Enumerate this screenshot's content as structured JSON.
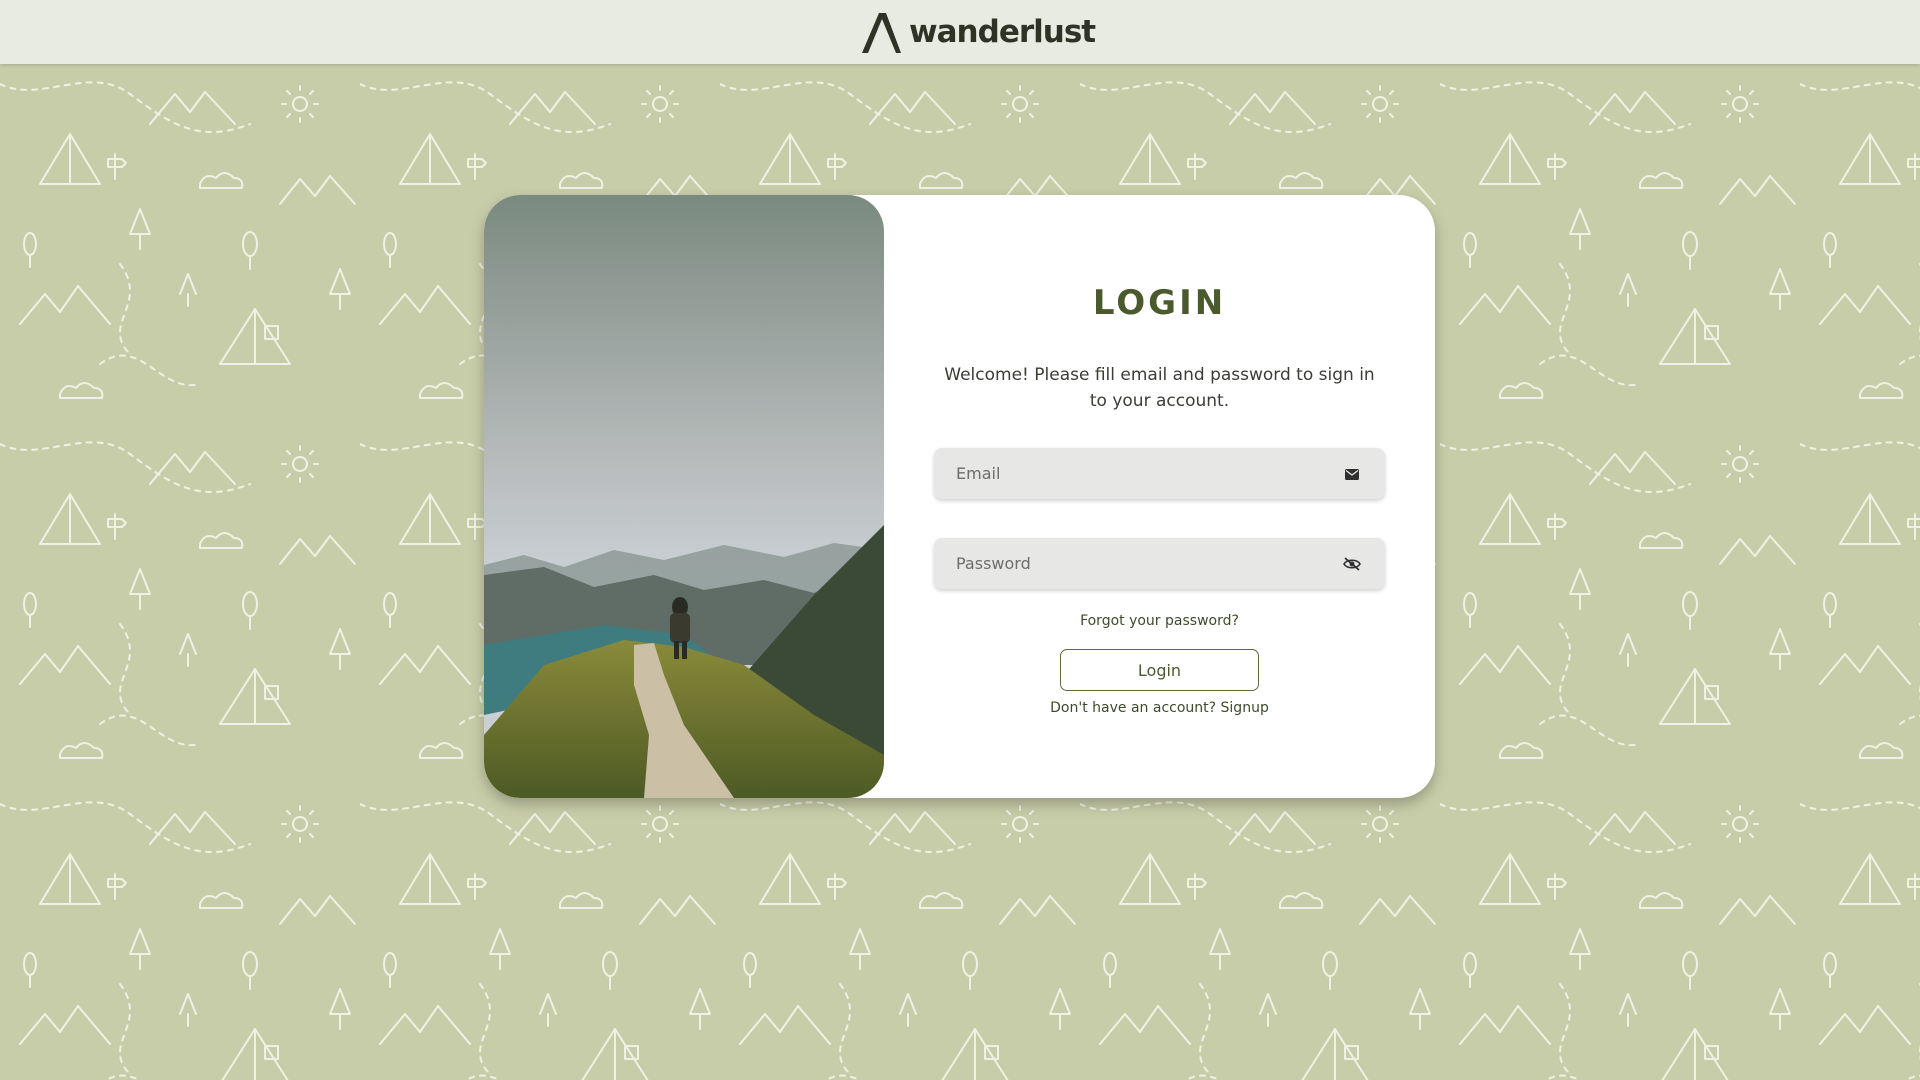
{
  "header": {
    "brand": "wanderlust"
  },
  "login": {
    "title": "LOGIN",
    "welcome": "Welcome! Please fill email and password to sign in to your account.",
    "email_placeholder": "Email",
    "password_placeholder": "Password",
    "forgot_label": "Forgot your password?",
    "button_label": "Login",
    "signup_prompt": "Don't have an account? ",
    "signup_link": "Signup"
  },
  "icons": {
    "email_field": "envelope-icon",
    "password_field": "eye-slash-icon"
  },
  "colors": {
    "background": "#c8cda9",
    "header": "#e8ebe1",
    "accent": "#4a5a2c",
    "input_bg": "#e7e7e6"
  }
}
